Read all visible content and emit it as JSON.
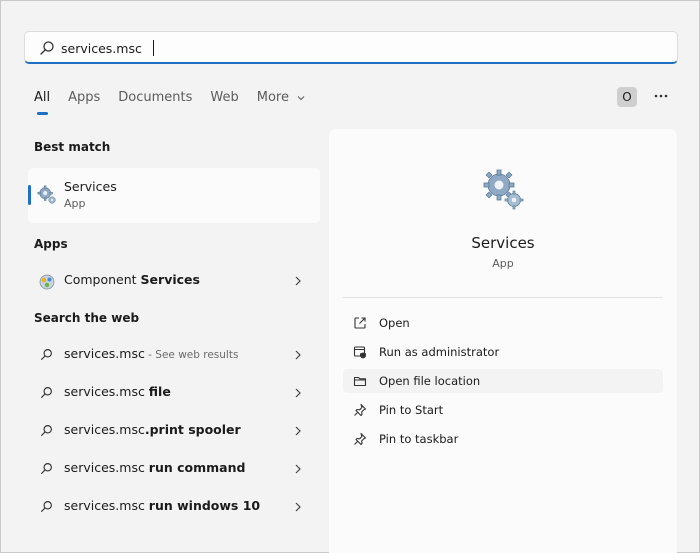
{
  "search": {
    "value": "services.msc",
    "placeholder": ""
  },
  "tabs": [
    {
      "label": "All"
    },
    {
      "label": "Apps"
    },
    {
      "label": "Documents"
    },
    {
      "label": "Web"
    },
    {
      "label": "More"
    }
  ],
  "header": {
    "avatar_letter": "O",
    "more_icon": "ellipsis-icon"
  },
  "best_match": {
    "heading": "Best match",
    "title": "Services",
    "subtitle": "App",
    "icon": "gears-icon"
  },
  "apps": {
    "heading": "Apps",
    "items": [
      {
        "prefix": "Component ",
        "bold": "Services",
        "icon": "component-services-icon"
      }
    ]
  },
  "web": {
    "heading": "Search the web",
    "items": [
      {
        "text": "services.msc",
        "bold": "",
        "hint": " - See web results"
      },
      {
        "text": "services.msc ",
        "bold": "file",
        "hint": ""
      },
      {
        "text": "services.msc",
        "bold": ".print spooler",
        "hint": ""
      },
      {
        "text": "services.msc ",
        "bold": "run command",
        "hint": ""
      },
      {
        "text": "services.msc ",
        "bold": "run windows 10",
        "hint": ""
      }
    ]
  },
  "preview": {
    "title": "Services",
    "subtitle": "App",
    "actions": [
      {
        "label": "Open",
        "icon": "open-external-icon"
      },
      {
        "label": "Run as administrator",
        "icon": "shield-admin-icon"
      },
      {
        "label": "Open file location",
        "icon": "folder-icon"
      },
      {
        "label": "Pin to Start",
        "icon": "pin-icon"
      },
      {
        "label": "Pin to taskbar",
        "icon": "pin-icon"
      }
    ]
  },
  "colors": {
    "accent": "#1f6fc4",
    "background": "#f3f3f3",
    "panel": "#fbfbfb"
  }
}
